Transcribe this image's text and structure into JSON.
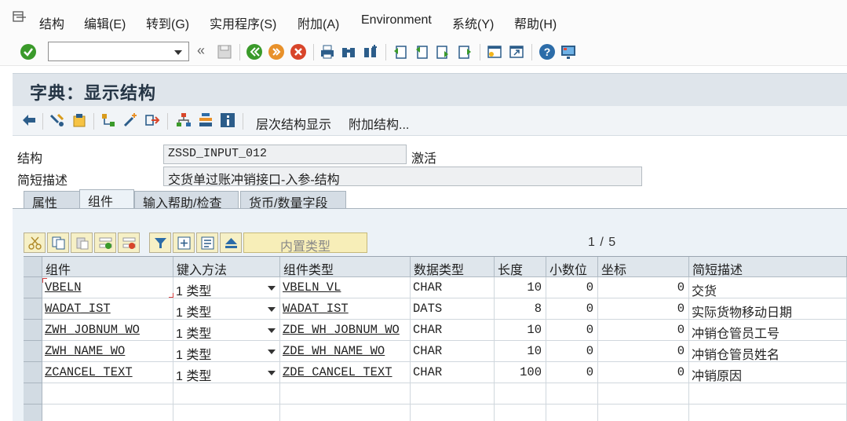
{
  "menu": {
    "items": [
      "结构",
      "编辑(E)",
      "转到(G)",
      "实用程序(S)",
      "附加(A)",
      "Environment",
      "系统(Y)",
      "帮助(H)"
    ]
  },
  "toolbar": {
    "command_value": "",
    "icons": [
      "enter-icon",
      "back-icon",
      "save-icon",
      "back-green-icon",
      "exit-icon",
      "cancel-icon",
      "print-icon",
      "find-icon",
      "find-next-icon",
      "first-page-icon",
      "previous-page-icon",
      "next-page-icon",
      "last-page-icon",
      "new-session-icon",
      "shortcut-icon",
      "help-icon",
      "layout-icon"
    ]
  },
  "page": {
    "title": "字典：显示结构"
  },
  "app_toolbar": {
    "hierarchy_label": "层次结构显示",
    "append_label": "附加结构..."
  },
  "header": {
    "structure_label": "结构",
    "structure_value": "ZSSD_INPUT_012",
    "status": "激活",
    "short_desc_label": "简短描述",
    "short_desc_value": "交货单过账冲销接口-入参-结构"
  },
  "tabs": [
    "属性",
    "组件",
    "输入帮助/检查",
    "货币/数量字段"
  ],
  "active_tab": "组件",
  "table": {
    "inner_type_label": "内置类型",
    "pager": "1 / 5",
    "columns": [
      "组件",
      "键入方法",
      "组件类型",
      "数据类型",
      "长度",
      "小数位",
      "坐标",
      "简短描述"
    ],
    "rows": [
      {
        "component": "VBELN",
        "typing": "1 类型",
        "comp_type": "VBELN_VL",
        "data_type": "CHAR",
        "length": "10",
        "decimals": "0",
        "coord": "0",
        "desc": "交货"
      },
      {
        "component": "WADAT_IST",
        "typing": "1 类型",
        "comp_type": "WADAT_IST",
        "data_type": "DATS",
        "length": "8",
        "decimals": "0",
        "coord": "0",
        "desc": "实际货物移动日期"
      },
      {
        "component": "ZWH_JOBNUM_WO",
        "typing": "1 类型",
        "comp_type": "ZDE_WH_JOBNUM_WO",
        "data_type": "CHAR",
        "length": "10",
        "decimals": "0",
        "coord": "0",
        "desc": "冲销仓管员工号"
      },
      {
        "component": "ZWH_NAME_WO",
        "typing": "1 类型",
        "comp_type": "ZDE_WH_NAME_WO",
        "data_type": "CHAR",
        "length": "10",
        "decimals": "0",
        "coord": "0",
        "desc": "冲销仓管员姓名"
      },
      {
        "component": "ZCANCEL_TEXT",
        "typing": "1 类型",
        "comp_type": "ZDE_CANCEL_TEXT",
        "data_type": "CHAR",
        "length": "100",
        "decimals": "0",
        "coord": "0",
        "desc": "冲销原因"
      }
    ]
  },
  "colors": {
    "title_bg": "#dfe5eb",
    "content_bg": "#ecf2f7",
    "accent_green": "#3a9a2a",
    "focus_red": "#d64040"
  }
}
